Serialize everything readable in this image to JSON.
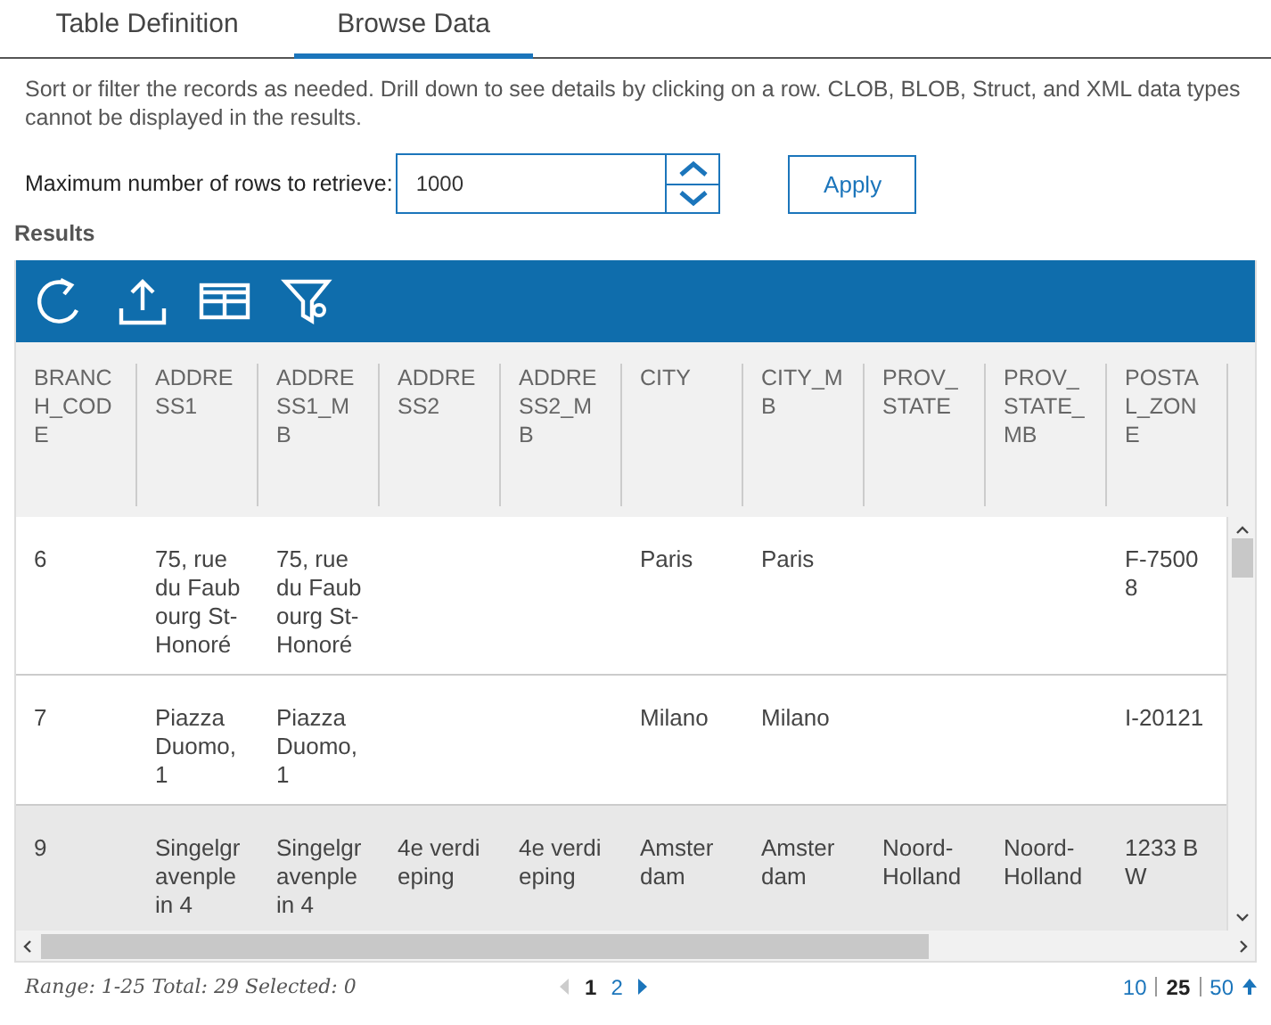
{
  "tabs": [
    {
      "label": "Table Definition",
      "selected": false
    },
    {
      "label": "Browse Data",
      "selected": true
    }
  ],
  "description": "Sort or filter the records as needed. Drill down to see details by clicking on a row. CLOB, BLOB, Struct, and XML data types cannot be displayed in the results.",
  "max_rows": {
    "label": "Maximum number of rows to retrieve:",
    "value": "1000"
  },
  "apply_button": "Apply",
  "results_title": "Results",
  "table": {
    "columns": [
      "BRANCH_CODE",
      "ADDRESS1",
      "ADDRESS1_MB",
      "ADDRESS2",
      "ADDRESS2_MB",
      "CITY",
      "CITY_MB",
      "PROV_STATE",
      "PROV_STATE_MB",
      "POSTAL_ZONE"
    ],
    "rows": [
      {
        "highlighted": false,
        "cells": [
          "6",
          "75, rue du Faubourg St-Honoré",
          "75, rue du Faubourg St-Honoré",
          "",
          "",
          "Paris",
          "Paris",
          "",
          "",
          "F-75008"
        ]
      },
      {
        "highlighted": false,
        "cells": [
          "7",
          "Piazza Duomo, 1",
          "Piazza Duomo, 1",
          "",
          "",
          "Milano",
          "Milano",
          "",
          "",
          "I-20121"
        ]
      },
      {
        "highlighted": true,
        "cells": [
          "9",
          "Singelgravenplein 4",
          "Singelgravenplein 4",
          "4e verdieping",
          "4e verdieping",
          "Amsterdam",
          "Amsterdam",
          "Noord-Holland",
          "Noord-Holland",
          "1233 BW"
        ]
      }
    ]
  },
  "footer": {
    "summary": "Range: 1-25 Total: 29 Selected: 0",
    "pages": [
      {
        "label": "1",
        "selected": true
      },
      {
        "label": "2",
        "selected": false
      }
    ],
    "page_sizes": [
      {
        "label": "10",
        "selected": false
      },
      {
        "label": "25",
        "selected": true
      },
      {
        "label": "50",
        "selected": false
      }
    ]
  }
}
